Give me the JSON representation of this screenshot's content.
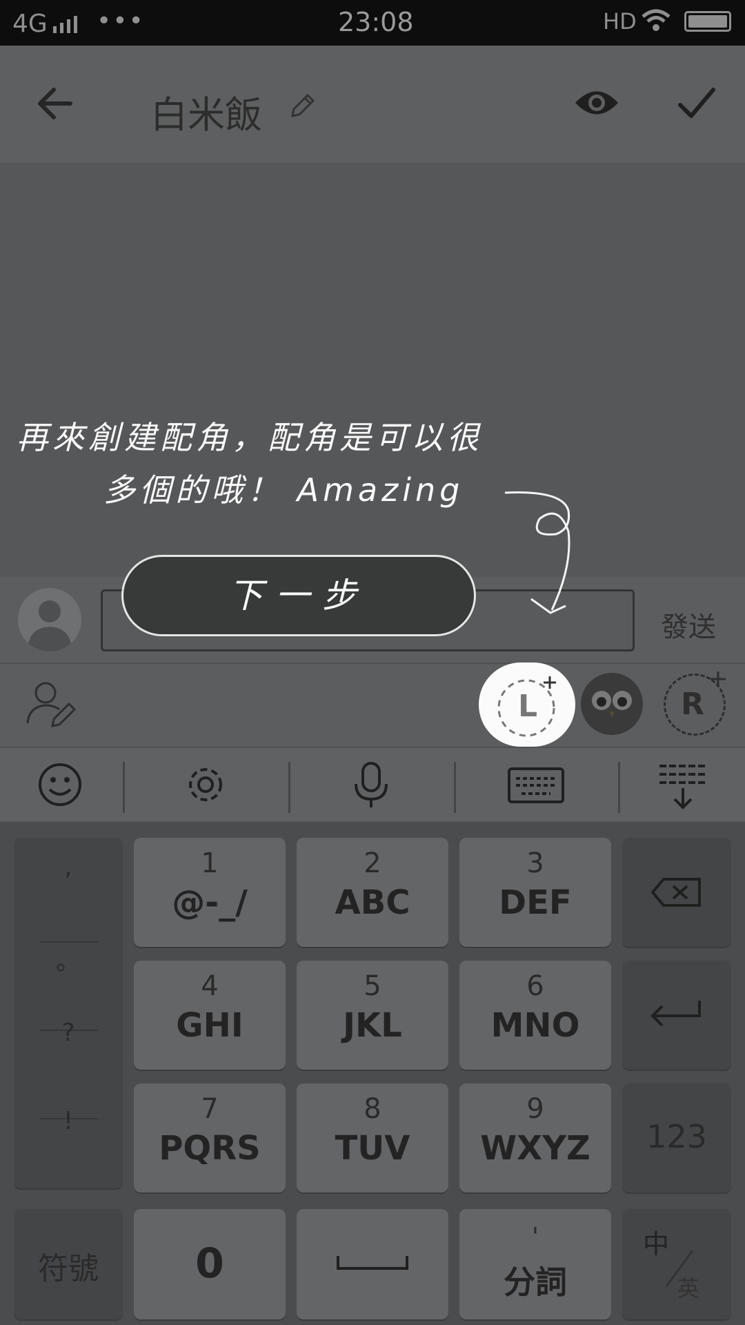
{
  "status_bar": {
    "network": "4G",
    "dots": "•••",
    "time": "23:08",
    "hd": "HD"
  },
  "header": {
    "title": "白米飯"
  },
  "input_bar": {
    "send_label": "發送"
  },
  "char_bar": {
    "left_slot_letter": "L",
    "right_slot_letter": "R"
  },
  "overlay": {
    "line1": "再來創建配角，配角是可以很",
    "line2": "多個的哦！ Amazing",
    "next_label": "下一步"
  },
  "keyboard": {
    "punctuation": [
      ",",
      "。",
      "?",
      "!"
    ],
    "keys": [
      {
        "number": "1",
        "letters": "@-_/"
      },
      {
        "number": "2",
        "letters": "ABC"
      },
      {
        "number": "3",
        "letters": "DEF"
      },
      {
        "number": "4",
        "letters": "GHI"
      },
      {
        "number": "5",
        "letters": "JKL"
      },
      {
        "number": "6",
        "letters": "MNO"
      },
      {
        "number": "7",
        "letters": "PQRS"
      },
      {
        "number": "8",
        "letters": "TUV"
      },
      {
        "number": "9",
        "letters": "WXYZ"
      }
    ],
    "numbers_key": "123",
    "symbols_key": "符號",
    "zero_key": "0",
    "split_key": "分詞",
    "split_key_mark": "'",
    "lang_zh": "中",
    "lang_en": "英"
  }
}
